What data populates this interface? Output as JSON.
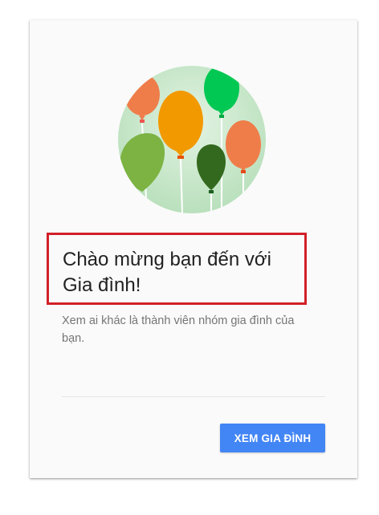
{
  "dialog": {
    "illustration": "balloons-illustration",
    "title": "Chào mừng bạn đến với Gia đình!",
    "subtitle": "Xem ai khác là thành viên nhóm gia đình của bạn.",
    "primary_button_label": "XEM GIA ĐÌNH"
  },
  "colors": {
    "accent": "#4285f4",
    "highlight_border": "#d22027",
    "circle_background": "#c8e6c9",
    "balloon_orange": "#ef7d4a",
    "balloon_amber": "#f29900",
    "balloon_green": "#00c853",
    "balloon_light_green": "#7cb342",
    "balloon_dark_green": "#33691e"
  }
}
